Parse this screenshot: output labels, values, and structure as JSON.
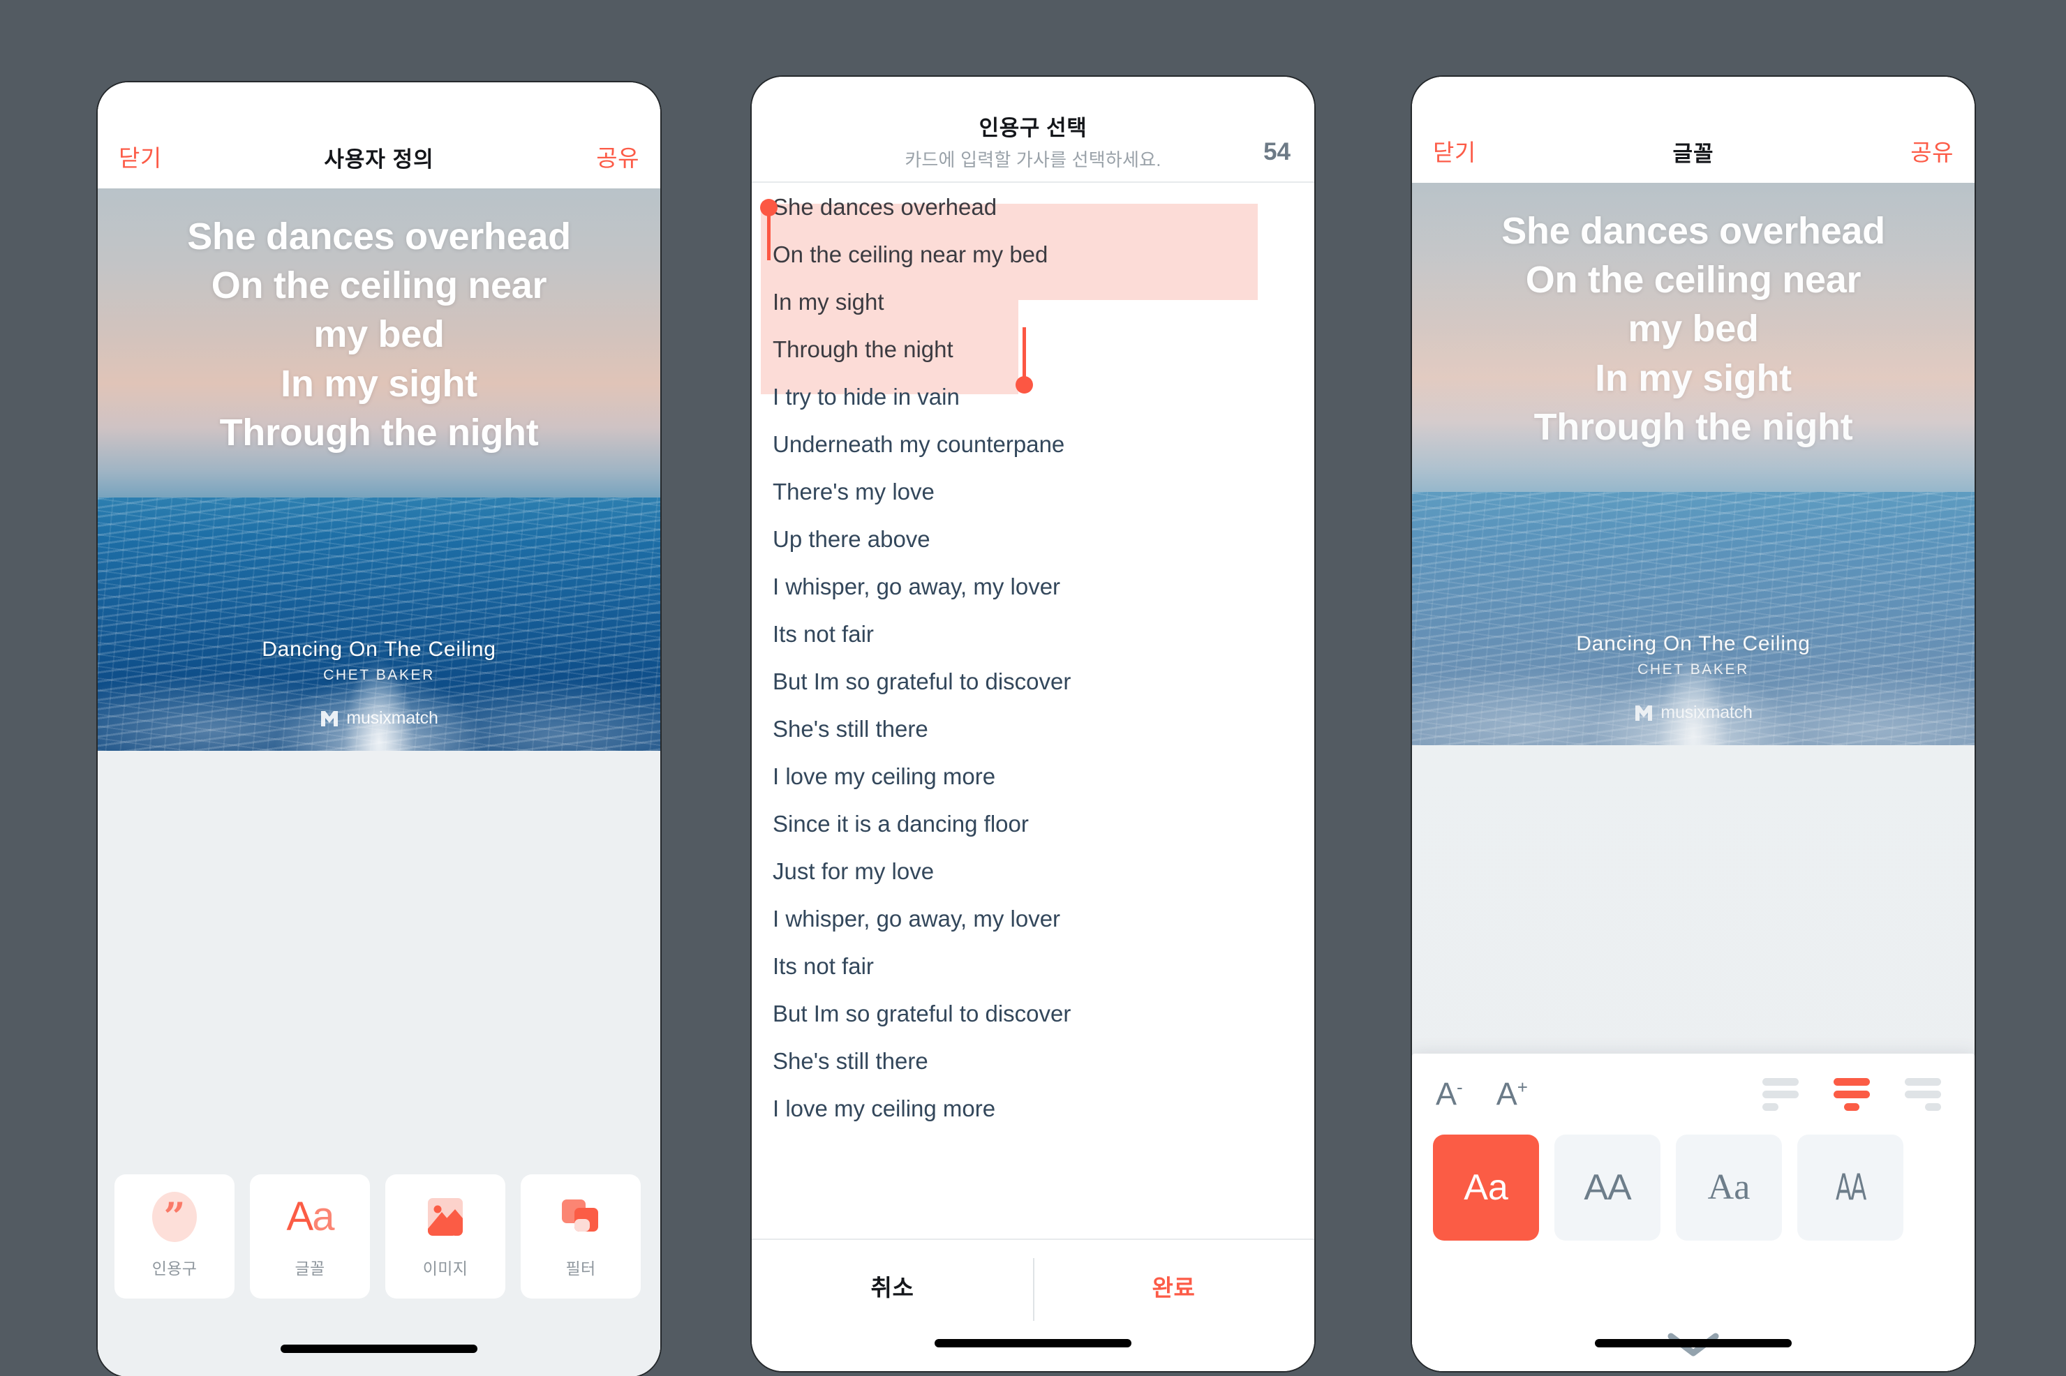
{
  "theme": {
    "accent": "#fc5b47",
    "accent_soft": "#fddfd9",
    "page_bg": "#535b62",
    "tray_bg": "#edf0f2",
    "lyric_text": "#33475b",
    "selection_bg": "#fcdcd7"
  },
  "card": {
    "lyrics": [
      "She dances overhead",
      "On the ceiling near",
      "my bed",
      "In my sight",
      "Through the night"
    ],
    "song_title": "Dancing On The Ceiling",
    "artist": "CHET BAKER",
    "brand": "musixmatch"
  },
  "panel1": {
    "nav": {
      "left": "닫기",
      "title": "사용자 정의",
      "right": "공유"
    },
    "tools": [
      {
        "label": "인용구",
        "icon": "quote-icon"
      },
      {
        "label": "글꼴",
        "icon": "font-aa-icon"
      },
      {
        "label": "이미지",
        "icon": "image-icon"
      },
      {
        "label": "필터",
        "icon": "filter-icon"
      }
    ]
  },
  "panel2": {
    "header": {
      "title": "인용구 선택",
      "subtitle": "카드에 입력할 가사를 선택하세요.",
      "count": "54"
    },
    "lyrics": [
      {
        "text": "She dances overhead",
        "selected": true
      },
      {
        "text": "On the ceiling near my bed",
        "selected": true
      },
      {
        "text": "In my sight",
        "selected": true
      },
      {
        "text": "Through the night",
        "selected": true
      },
      {
        "text": "I try to hide in vain",
        "selected": false
      },
      {
        "text": "Underneath my counterpane",
        "selected": false
      },
      {
        "text": "There's my love",
        "selected": false
      },
      {
        "text": "Up there above",
        "selected": false
      },
      {
        "text": "I whisper, go away, my lover",
        "selected": false
      },
      {
        "text": "Its not fair",
        "selected": false
      },
      {
        "text": "But Im so grateful to discover",
        "selected": false
      },
      {
        "text": "She's still there",
        "selected": false
      },
      {
        "text": "I love my ceiling more",
        "selected": false
      },
      {
        "text": "Since it is a dancing floor",
        "selected": false
      },
      {
        "text": "Just for my love",
        "selected": false
      },
      {
        "text": "I whisper, go away, my lover",
        "selected": false
      },
      {
        "text": "Its not fair",
        "selected": false
      },
      {
        "text": "But Im so grateful to discover",
        "selected": false
      },
      {
        "text": "She's still there",
        "selected": false
      },
      {
        "text": "I love my ceiling more",
        "selected": false
      }
    ],
    "footer": {
      "cancel": "취소",
      "done": "완료"
    }
  },
  "panel3": {
    "nav": {
      "left": "닫기",
      "title": "글꼴",
      "right": "공유"
    },
    "font_sheet": {
      "decrease_label": "A",
      "decrease_sup": "-",
      "increase_label": "A",
      "increase_sup": "+",
      "alignment_selected": "center",
      "alignments": [
        "left",
        "center",
        "right"
      ],
      "fonts": [
        {
          "sample": "Aa",
          "style": "sans",
          "selected": true
        },
        {
          "sample": "AA",
          "style": "sans",
          "selected": false
        },
        {
          "sample": "Aa",
          "style": "serif",
          "selected": false
        },
        {
          "sample": "AA",
          "style": "condensed",
          "selected": false
        }
      ]
    }
  }
}
